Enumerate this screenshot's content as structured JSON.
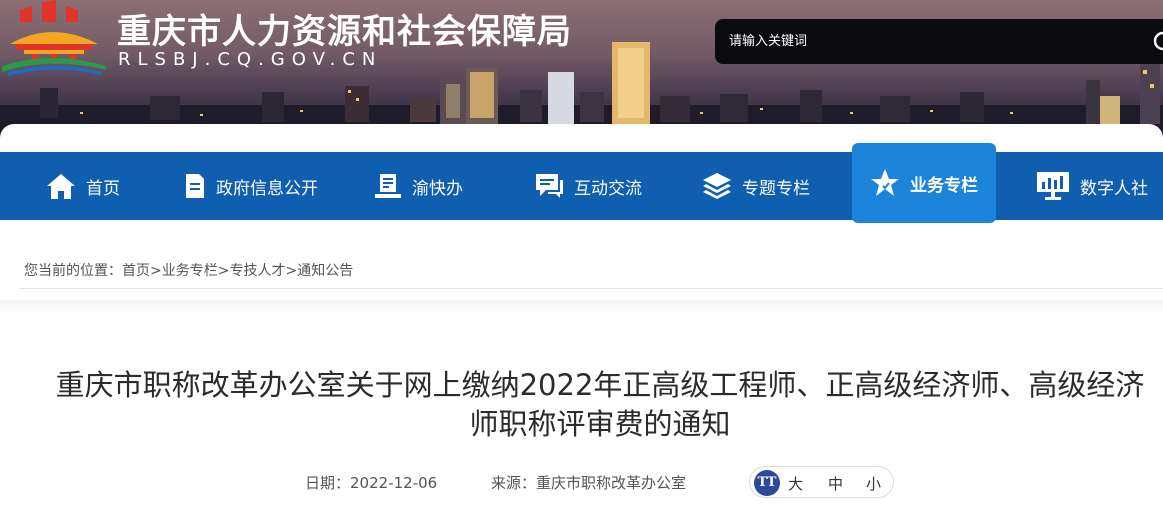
{
  "header": {
    "site_title": "重庆市人力资源和社会保障局",
    "site_domain": "RLSBJ.CQ.GOV.CN",
    "search_placeholder": "请输入关键词"
  },
  "nav": {
    "items": [
      {
        "label": "首页",
        "icon": "home-icon"
      },
      {
        "label": "政府信息公开",
        "icon": "document-icon"
      },
      {
        "label": "渝快办",
        "icon": "book-icon"
      },
      {
        "label": "互动交流",
        "icon": "chat-icon"
      },
      {
        "label": "专题专栏",
        "icon": "layers-icon"
      },
      {
        "label": "业务专栏",
        "icon": "star-icon",
        "active": true
      },
      {
        "label": "数字人社",
        "icon": "monitor-chart-icon"
      }
    ],
    "bg_color": "#0f5eb0",
    "active_color": "#1d84db"
  },
  "breadcrumb": {
    "prefix": "您当前的位置：",
    "items": [
      "首页",
      "业务专栏",
      "专技人才",
      "通知公告"
    ],
    "separator": ">"
  },
  "article": {
    "title_line1": "重庆市职称改革办公室关于网上缴纳2022年正高级工程师、正高级经济师、高级经济",
    "title_line2": "师职称评审费的通知",
    "date_label": "日期：",
    "date": "2022-12-06",
    "source_label": "来源：",
    "source": "重庆市职称改革办公室"
  },
  "font_size": {
    "icon_text": "TT",
    "large": "大",
    "medium": "中",
    "small": "小"
  }
}
